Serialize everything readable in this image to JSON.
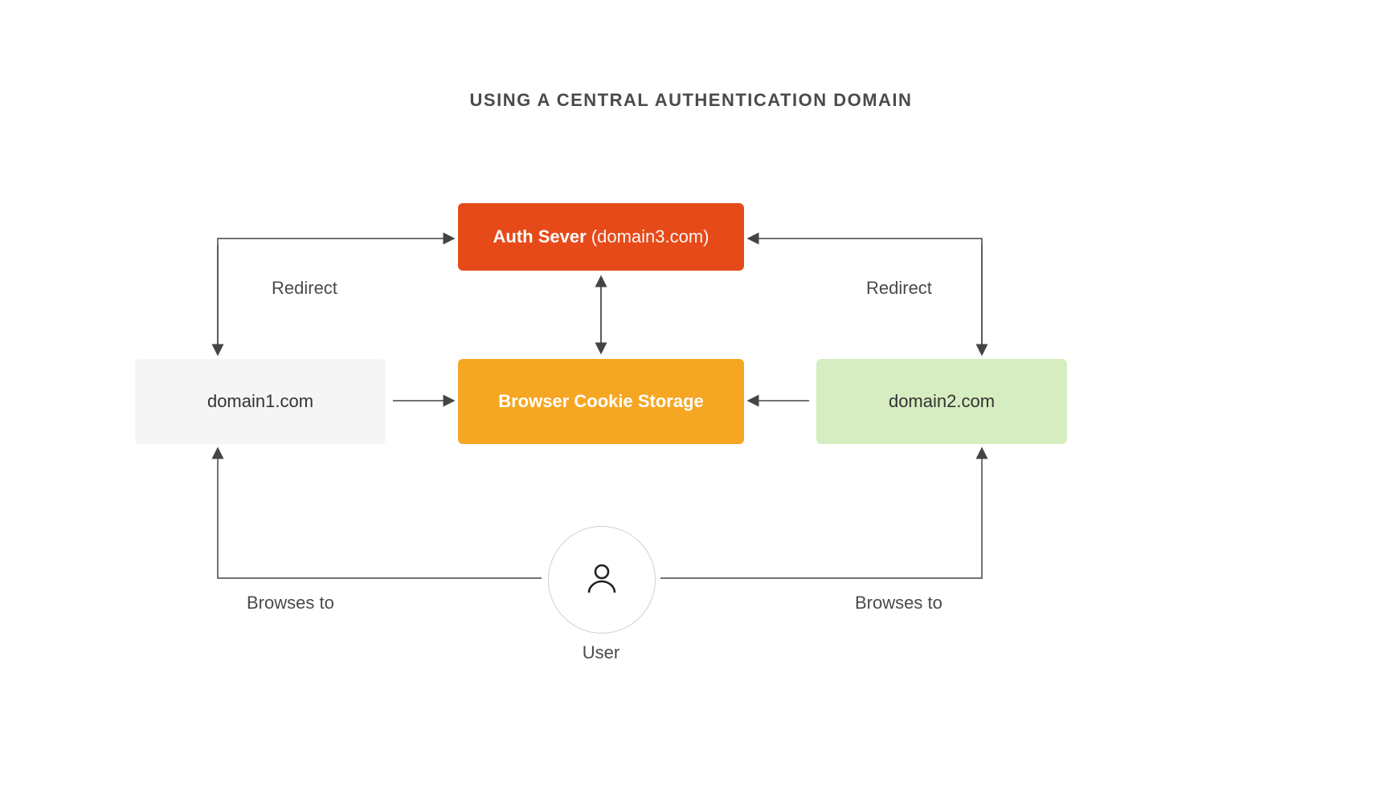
{
  "title": "USING A CENTRAL AUTHENTICATION DOMAIN",
  "auth": {
    "bold": "Auth Sever",
    "domain": "(domain3.com)"
  },
  "cookie": "Browser Cookie Storage",
  "domain1": "domain1.com",
  "domain2": "domain2.com",
  "user_label": "User",
  "labels": {
    "redirect_left": "Redirect",
    "redirect_right": "Redirect",
    "browses_left": "Browses to",
    "browses_right": "Browses to"
  },
  "colors": {
    "auth": "#E64A19",
    "cookie": "#F5A623",
    "domain1_bg": "#F5F5F5",
    "domain2_bg": "#D6EDC1",
    "arrow": "#444444"
  }
}
